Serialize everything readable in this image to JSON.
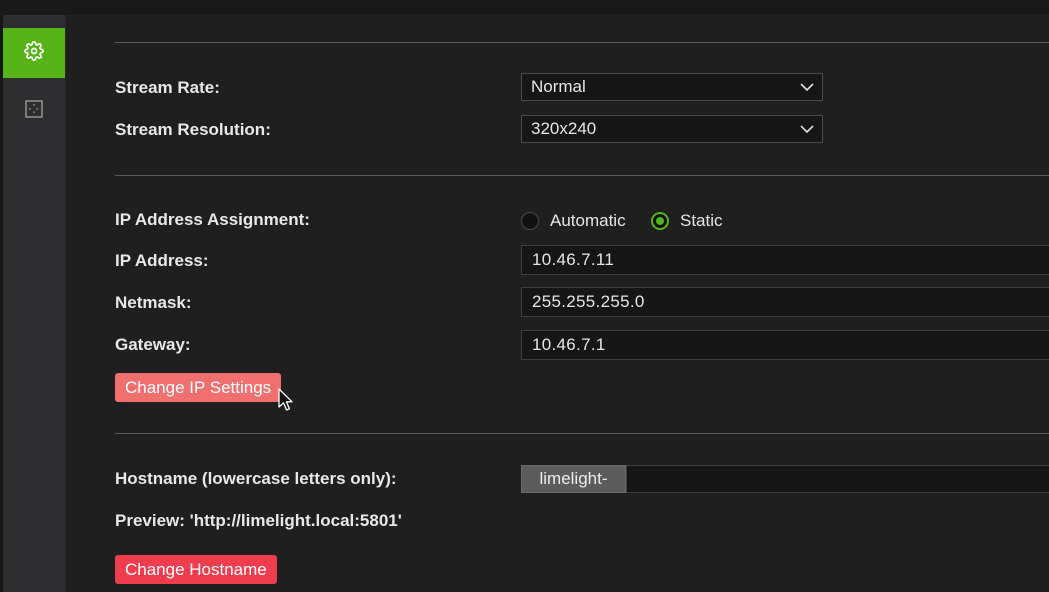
{
  "sidebar": {
    "items": [
      {
        "icon": "gear-icon",
        "active": true
      },
      {
        "icon": "crosshair-grid-icon",
        "active": false
      }
    ],
    "accent": "#56b418"
  },
  "stream": {
    "rate_label": "Stream Rate:",
    "rate_value": "Normal",
    "resolution_label": "Stream Resolution:",
    "resolution_value": "320x240"
  },
  "network": {
    "assignment_label": "IP Address Assignment:",
    "automatic_label": "Automatic",
    "static_label": "Static",
    "selected": "Static",
    "ip_label": "IP Address:",
    "ip_value": "10.46.7.11",
    "netmask_label": "Netmask:",
    "netmask_value": "255.255.255.0",
    "gateway_label": "Gateway:",
    "gateway_value": "10.46.7.1",
    "change_button": "Change IP Settings"
  },
  "hostname": {
    "label": "Hostname (lowercase letters only):",
    "prefix": "limelight-",
    "value": "",
    "preview": "Preview: 'http://limelight.local:5801'",
    "change_button": "Change Hostname"
  }
}
